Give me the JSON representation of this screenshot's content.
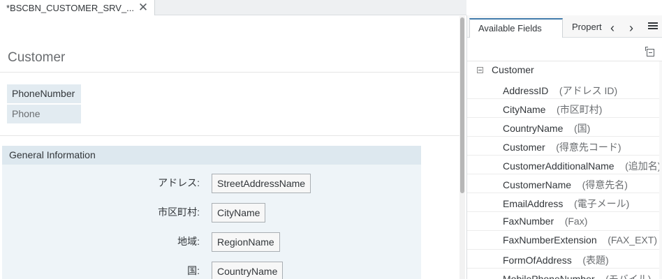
{
  "editor_tab": {
    "label": "*BSCBN_CUSTOMER_SRV_...",
    "close_glyph": "✕"
  },
  "page": {
    "title": "Customer",
    "header_fields": [
      "PhoneNumber",
      "Phone"
    ]
  },
  "section": {
    "title": "General Information",
    "rows": [
      {
        "label": "アドレス:",
        "field": "StreetAddressName"
      },
      {
        "label": "市区町村:",
        "field": "CityName"
      },
      {
        "label": "地域:",
        "field": "RegionName"
      },
      {
        "label": "国:",
        "field": "CountryName"
      }
    ]
  },
  "panel": {
    "tabs": {
      "active": "Available Fields",
      "inactive": "Properties"
    },
    "nav": {
      "prev": "‹",
      "next": "›"
    },
    "root": "Customer",
    "fields": [
      {
        "name": "AddressID",
        "desc": "(アドレス ID)"
      },
      {
        "name": "CityName",
        "desc": "(市区町村)"
      },
      {
        "name": "CountryName",
        "desc": "(国)"
      },
      {
        "name": "Customer",
        "desc": "(得意先コード)"
      },
      {
        "name": "CustomerAdditionalName",
        "desc": "(追加名)"
      },
      {
        "name": "CustomerName",
        "desc": "(得意先名)"
      },
      {
        "name": "EmailAddress",
        "desc": "(電子メール)"
      },
      {
        "name": "FaxNumber",
        "desc": "(Fax)"
      },
      {
        "name": "FaxNumberExtension",
        "desc": "(FAX_EXT)"
      },
      {
        "name": "FormOfAddress",
        "desc": "(表題)"
      },
      {
        "name": "MobilePhoneNumber",
        "desc": "(モバイル)"
      }
    ]
  },
  "colors": {
    "accent": "#427cac",
    "header_bg": "#e2ebf1",
    "section_bg": "#eef4f8"
  },
  "icons": {
    "collapse_all": "collapse-all-icon",
    "menu": "menu-icon",
    "tree_toggle": "minus-square-icon"
  }
}
